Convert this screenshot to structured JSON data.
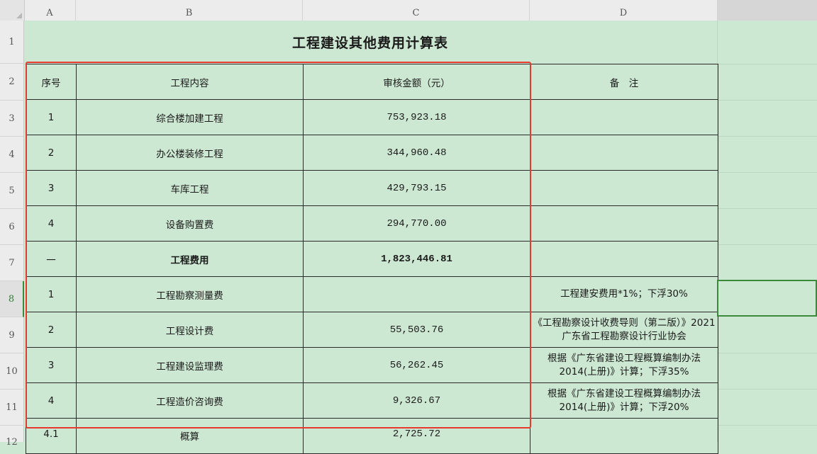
{
  "columns": [
    "A",
    "B",
    "C",
    "D"
  ],
  "rows": [
    "1",
    "2",
    "3",
    "4",
    "5",
    "6",
    "7",
    "8",
    "9",
    "10",
    "11",
    "12"
  ],
  "title": "工程建设其他费用计算表",
  "header": [
    "序号",
    "工程内容",
    "审核金额（元）",
    "备　注"
  ],
  "table_rows": [
    {
      "no": "1",
      "item": "综合楼加建工程",
      "amount": "753,923.18",
      "note": ""
    },
    {
      "no": "2",
      "item": "办公楼装修工程",
      "amount": "344,960.48",
      "note": ""
    },
    {
      "no": "3",
      "item": "车库工程",
      "amount": "429,793.15",
      "note": ""
    },
    {
      "no": "4",
      "item": "设备购置费",
      "amount": "294,770.00",
      "note": ""
    },
    {
      "no": "一",
      "item": "工程费用",
      "amount": "1,823,446.81",
      "note": ""
    },
    {
      "no": "1",
      "item": "工程勘察测量费",
      "amount": "",
      "note": "工程建安费用*1%；下浮30%"
    },
    {
      "no": "2",
      "item": "工程设计费",
      "amount": "55,503.76",
      "note": "《工程勘察设计收费导则（第二版）》2021 广东省工程勘察设计行业协会"
    },
    {
      "no": "3",
      "item": "工程建设监理费",
      "amount": "56,262.45",
      "note": "根据《广东省建设工程概算编制办法2014(上册)》计算；下浮35%"
    },
    {
      "no": "4",
      "item": "工程造价咨询费",
      "amount": "9,326.67",
      "note": "根据《广东省建设工程概算编制办法2014(上册)》计算；下浮20%"
    },
    {
      "no": "4.1",
      "item": "概算",
      "amount": "2,725.72",
      "note": ""
    }
  ],
  "active_row": "8",
  "accent_color": "#e8392e"
}
